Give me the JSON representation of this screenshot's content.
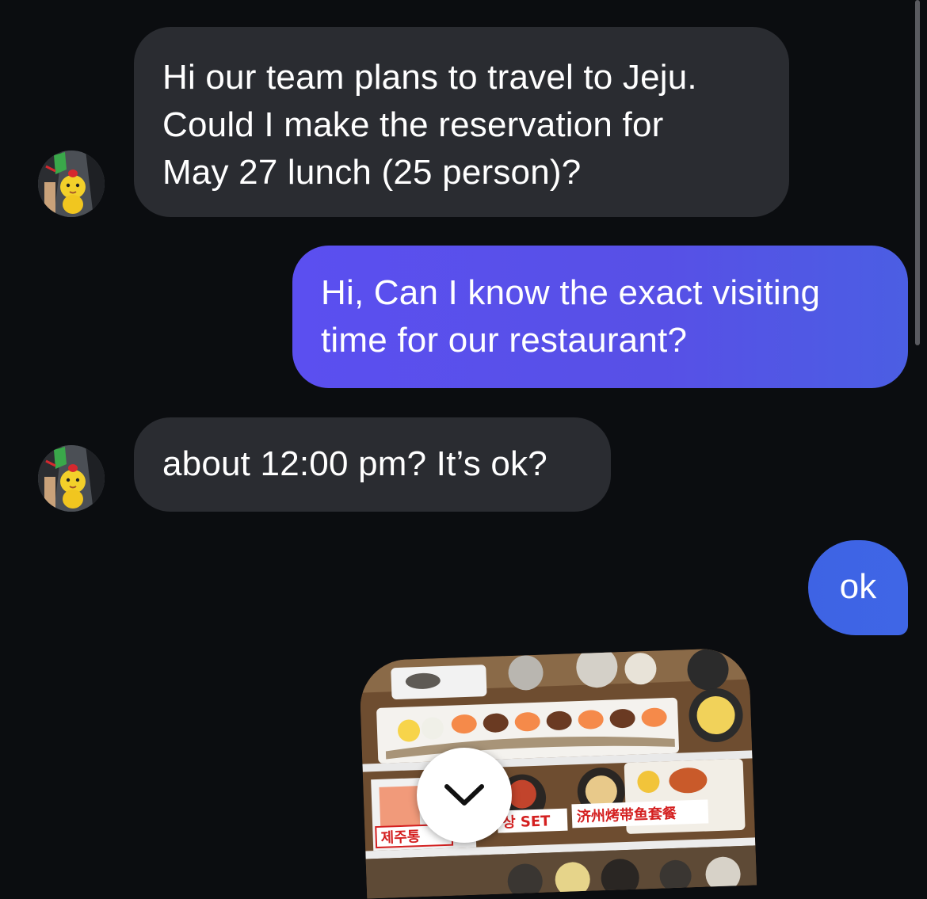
{
  "messages": [
    {
      "from": "other",
      "lines": [
        "Hi our team plans to travel to Jeju.",
        "Could I make the reservation for",
        "May 27 lunch (25 person)?"
      ]
    },
    {
      "from": "me",
      "lines": [
        "Hi, Can I know the exact visiting",
        "time for our restaurant?"
      ]
    },
    {
      "from": "other",
      "lines": [
        "about 12:00 pm? It’s ok?"
      ]
    },
    {
      "from": "me",
      "lines": [
        "ok"
      ]
    }
  ],
  "photo": {
    "sign_left": "제주통",
    "sign_mid": "상 SET",
    "sign_right": "济州烤带鱼套餐"
  },
  "icons": {
    "avatar": "avatar-character-icon",
    "scroll_down": "chevron-down-icon"
  },
  "colors": {
    "background": "#0b0d10",
    "received_bubble": "#2a2c31",
    "sent_bubble_start": "#5b4ff0",
    "sent_bubble_end": "#3f66e6",
    "text": "#ffffff"
  }
}
